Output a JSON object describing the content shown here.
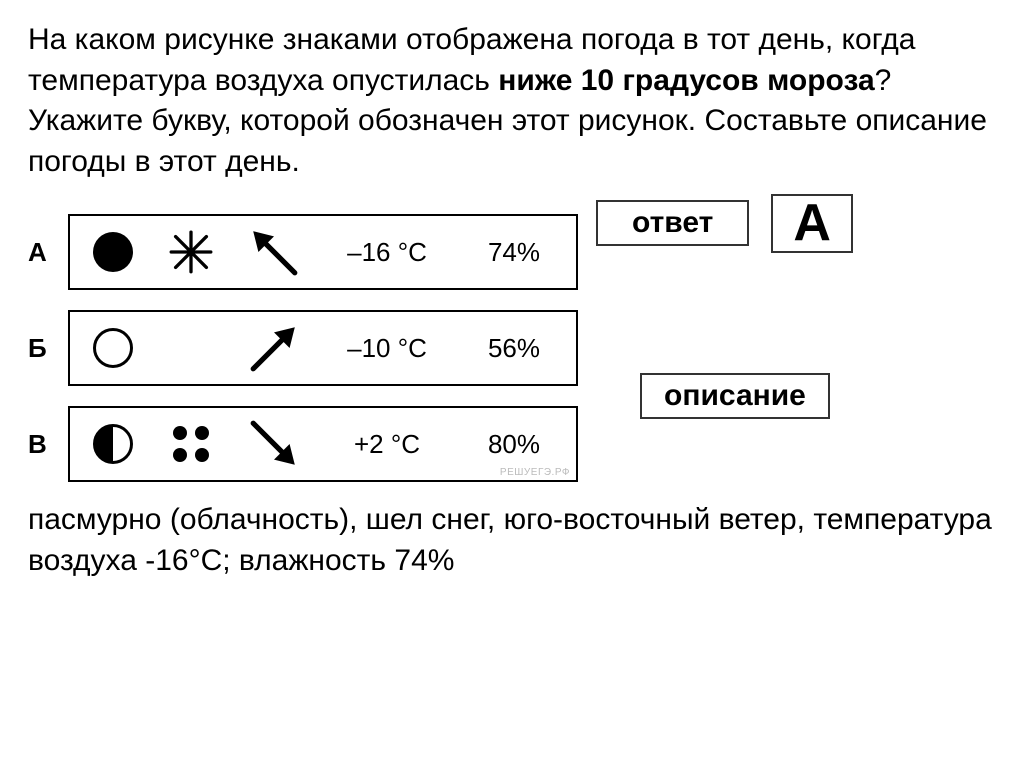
{
  "question": {
    "p1": "На каком рисунке знаками отображена погода в тот день, когда температура воздуха опустилась ",
    "bold": "ниже 10 градусов мороза",
    "p2": "? Укажите букву, которой обозначен этот рисунок. Составьте описание погоды в этот день."
  },
  "labels": {
    "answer": "ответ",
    "description": "описание"
  },
  "answer": "А",
  "chart_data": {
    "type": "table",
    "columns": [
      "letter",
      "cloud_cover",
      "precipitation",
      "wind",
      "temperature",
      "humidity"
    ],
    "rows": [
      {
        "letter": "А",
        "cloud_cover": "overcast",
        "precipitation": "snow",
        "wind": {
          "direction": "SE",
          "arrow": "up-left"
        },
        "temperature": "–16 °C",
        "humidity": "74%"
      },
      {
        "letter": "Б",
        "cloud_cover": "clear",
        "precipitation": "none",
        "wind": {
          "direction": "SW",
          "arrow": "up-right"
        },
        "temperature": "–10 °C",
        "humidity": "56%"
      },
      {
        "letter": "В",
        "cloud_cover": "partly-cloudy",
        "precipitation": "rain",
        "wind": {
          "direction": "NW",
          "arrow": "down-right"
        },
        "temperature": "+2 °C",
        "humidity": "80%"
      }
    ]
  },
  "description": "пасмурно (облачность), шел снег, юго-восточный ветер, температура воздуха -16°C; влажность 74%",
  "watermark": "РЕШУЕГЭ.РФ"
}
